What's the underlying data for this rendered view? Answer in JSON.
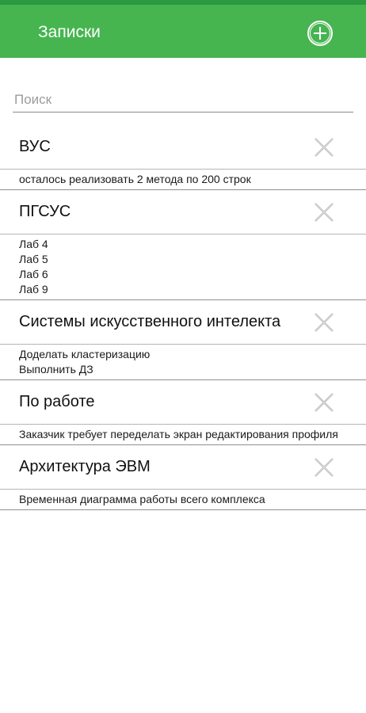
{
  "appbar": {
    "title": "Записки",
    "add_icon": "plus-circle-icon",
    "color": "#46b550"
  },
  "search": {
    "placeholder": "Поиск",
    "value": ""
  },
  "notes": [
    {
      "title": "ВУС",
      "lines": [
        "осталось реализовать 2 метода по 200 строк"
      ]
    },
    {
      "title": "ПГСУС",
      "lines": [
        "Лаб 4",
        "Лаб 5",
        "Лаб 6",
        "Лаб 9"
      ]
    },
    {
      "title": "Системы искусственного интелекта",
      "lines": [
        "Доделать кластеризацию",
        "Выполнить ДЗ"
      ]
    },
    {
      "title": "По работе",
      "lines": [
        "Заказчик требует переделать экран редактирования профиля"
      ]
    },
    {
      "title": "Архитектура ЭВМ",
      "lines": [
        "Временная диаграмма работы всего комплекса"
      ]
    }
  ],
  "delete_icon": "close-icon"
}
